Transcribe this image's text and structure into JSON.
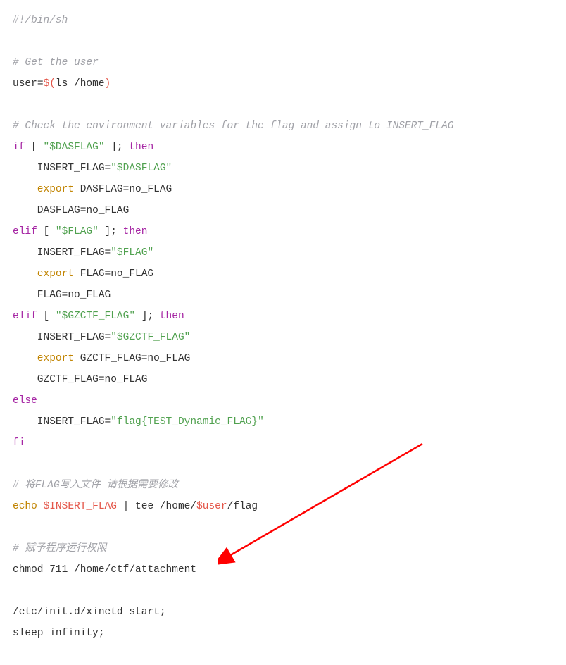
{
  "code": {
    "l1_shebang": "#!/bin/sh",
    "l3_cmt": "# Get the user",
    "l4_user": "user",
    "l4_eq": "=",
    "l4_sub_open": "$(",
    "l4_ls": "ls",
    "l4_path": " /home",
    "l4_sub_close": ")",
    "l6_cmt": "# Check the environment variables for the flag and assign to INSERT_FLAG",
    "l7_if": "if",
    "l7_lbr": " [ ",
    "l7_str": "\"$DASFLAG\"",
    "l7_rbr": " ]; ",
    "l7_then": "then",
    "l8_indent": "    INSERT_FLAG=",
    "l8_str": "\"$DASFLAG\"",
    "l9_export": "    export",
    "l9_rest": " DASFLAG=no_FLAG",
    "l10": "    DASFLAG=no_FLAG",
    "l11_elif": "elif",
    "l11_lbr": " [ ",
    "l11_str": "\"$FLAG\"",
    "l11_rbr": " ]; ",
    "l11_then": "then",
    "l12": "    INSERT_FLAG=",
    "l12_str": "\"$FLAG\"",
    "l13_export": "    export",
    "l13_rest": " FLAG=no_FLAG",
    "l14": "    FLAG=no_FLAG",
    "l15_elif": "elif",
    "l15_lbr": " [ ",
    "l15_str": "\"$GZCTF_FLAG\"",
    "l15_rbr": " ]; ",
    "l15_then": "then",
    "l16": "    INSERT_FLAG=",
    "l16_str": "\"$GZCTF_FLAG\"",
    "l17_export": "    export",
    "l17_rest": " GZCTF_FLAG=no_FLAG",
    "l18": "    GZCTF_FLAG=no_FLAG",
    "l19_else": "else",
    "l20": "    INSERT_FLAG=",
    "l20_str": "\"flag{TEST_Dynamic_FLAG}\"",
    "l21_fi": "fi",
    "l23_cmt": "# 将FLAG写入文件 请根据需要修改",
    "l24_echo": "echo",
    "l24_var": " $INSERT_FLAG",
    "l24_pipe": " | ",
    "l24_tee": "tee",
    "l24_path": " /home/",
    "l24_user": "$user",
    "l24_flag": "/flag",
    "l26_cmt": "# 赋予程序运行权限",
    "l27_chmod": "chmod",
    "l27_rest": " 711 /home/ctf/attachment",
    "l29": "/etc/init.d/xinetd start;",
    "l30_sleep": "sleep",
    "l30_rest": " infinity;"
  },
  "arrow": {
    "color": "#ff0000"
  }
}
